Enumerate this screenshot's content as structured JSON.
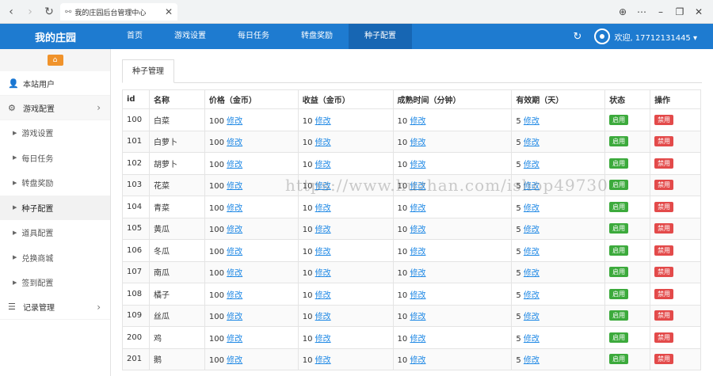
{
  "browser": {
    "tab_title": "我的庄园后台管理中心",
    "icons": {
      "back": "‹",
      "forward": "›",
      "reload": "↻",
      "link": "⚯",
      "close": "✕",
      "globe": "⊕",
      "more": "⋯",
      "minimize": "–",
      "restore": "❐",
      "close_window": "✕"
    }
  },
  "header": {
    "brand": "我的庄园",
    "nav": [
      "首页",
      "游戏设置",
      "每日任务",
      "转盘奖励",
      "种子配置"
    ],
    "active_nav": 4,
    "user_label": "欢迎, 17712131445 ▾"
  },
  "sidebar": {
    "home_icon": "⌂",
    "items": [
      {
        "label": "本站用户",
        "icon": "user-icon",
        "glyph": "👤"
      },
      {
        "label": "游戏配置",
        "icon": "gears-icon",
        "glyph": "⚙",
        "chev": "›"
      }
    ],
    "subitems": [
      "游戏设置",
      "每日任务",
      "转盘奖励",
      "种子配置",
      "道具配置",
      "兑换商城",
      "签到配置"
    ],
    "active_sub": 3,
    "bottom": {
      "label": "记录管理",
      "glyph": "☰",
      "chev": "›"
    }
  },
  "panel": {
    "tab": "种子管理"
  },
  "table": {
    "headers": [
      "id",
      "名称",
      "价格（金币）",
      "收益（金币）",
      "成熟时间（分钟）",
      "有效期（天）",
      "状态",
      "操作"
    ],
    "edit_label": "修改",
    "rows": [
      {
        "id": "100",
        "name": "白菜",
        "price": "100",
        "profit": "10",
        "time": "10",
        "valid": "5",
        "status": "启用",
        "action": "禁用"
      },
      {
        "id": "101",
        "name": "白萝卜",
        "price": "100",
        "profit": "10",
        "time": "10",
        "valid": "5",
        "status": "启用",
        "action": "禁用"
      },
      {
        "id": "102",
        "name": "胡萝卜",
        "price": "100",
        "profit": "10",
        "time": "10",
        "valid": "5",
        "status": "启用",
        "action": "禁用"
      },
      {
        "id": "103",
        "name": "花菜",
        "price": "100",
        "profit": "10",
        "time": "10",
        "valid": "5",
        "status": "启用",
        "action": "禁用"
      },
      {
        "id": "104",
        "name": "青菜",
        "price": "100",
        "profit": "10",
        "time": "10",
        "valid": "5",
        "status": "启用",
        "action": "禁用"
      },
      {
        "id": "105",
        "name": "黄瓜",
        "price": "100",
        "profit": "10",
        "time": "10",
        "valid": "5",
        "status": "启用",
        "action": "禁用"
      },
      {
        "id": "106",
        "name": "冬瓜",
        "price": "100",
        "profit": "10",
        "time": "10",
        "valid": "5",
        "status": "启用",
        "action": "禁用"
      },
      {
        "id": "107",
        "name": "南瓜",
        "price": "100",
        "profit": "10",
        "time": "10",
        "valid": "5",
        "status": "启用",
        "action": "禁用"
      },
      {
        "id": "108",
        "name": "橘子",
        "price": "100",
        "profit": "10",
        "time": "10",
        "valid": "5",
        "status": "启用",
        "action": "禁用"
      },
      {
        "id": "109",
        "name": "丝瓜",
        "price": "100",
        "profit": "10",
        "time": "10",
        "valid": "5",
        "status": "启用",
        "action": "禁用"
      },
      {
        "id": "200",
        "name": "鸡",
        "price": "100",
        "profit": "10",
        "time": "10",
        "valid": "5",
        "status": "启用",
        "action": "禁用"
      },
      {
        "id": "201",
        "name": "鹅",
        "price": "100",
        "profit": "10",
        "time": "10",
        "valid": "5",
        "status": "启用",
        "action": "禁用"
      }
    ]
  },
  "watermark": "https://www.huzhan.com/ishop49730",
  "colors": {
    "header": "#1e7bd0",
    "active_nav": "#1766b3",
    "enabled": "#3caa3c",
    "disabled": "#e34a4a",
    "link": "#1e88e5",
    "home": "#f0932b"
  }
}
